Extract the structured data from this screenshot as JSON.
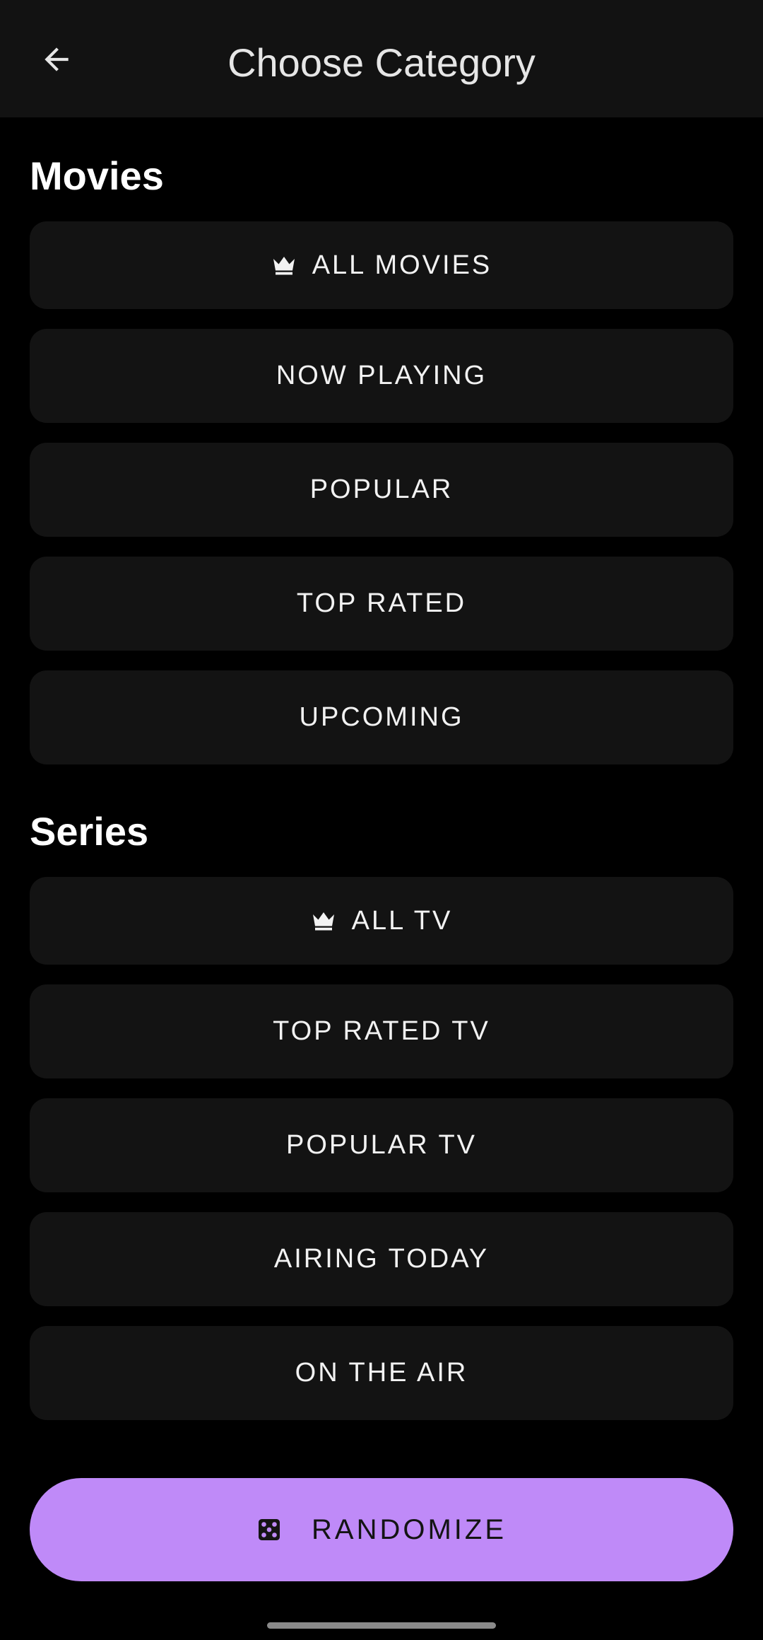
{
  "header": {
    "title": "Choose Category"
  },
  "sections": [
    {
      "title": "Movies",
      "items": [
        {
          "label": "ALL MOVIES",
          "icon": "crown-icon"
        },
        {
          "label": "NOW PLAYING"
        },
        {
          "label": "POPULAR"
        },
        {
          "label": "TOP RATED"
        },
        {
          "label": "UPCOMING"
        }
      ]
    },
    {
      "title": "Series",
      "items": [
        {
          "label": "ALL TV",
          "icon": "crown-icon"
        },
        {
          "label": "TOP RATED TV"
        },
        {
          "label": "POPULAR TV"
        },
        {
          "label": "AIRING TODAY"
        },
        {
          "label": "ON THE AIR"
        }
      ]
    }
  ],
  "randomize": {
    "label": "RANDOMIZE",
    "icon": "dice-icon"
  },
  "colors": {
    "accent": "#bf8af8",
    "background": "#000000",
    "surface": "#131313",
    "appbar": "#121212"
  }
}
